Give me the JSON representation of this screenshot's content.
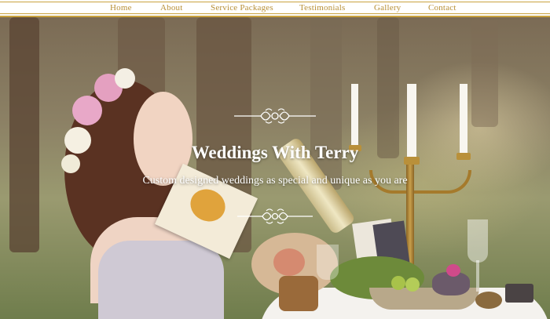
{
  "nav": {
    "items": [
      {
        "label": "Home"
      },
      {
        "label": "About"
      },
      {
        "label": "Service Packages"
      },
      {
        "label": "Testimonials"
      },
      {
        "label": "Gallery"
      },
      {
        "label": "Contact"
      }
    ]
  },
  "hero": {
    "title": "Weddings With Terry",
    "subtitle": "Custom designed weddings as special and unique as you are"
  },
  "colors": {
    "accent_gold": "#c9a23e",
    "nav_text": "#b89038",
    "hero_text": "#ffffff"
  }
}
